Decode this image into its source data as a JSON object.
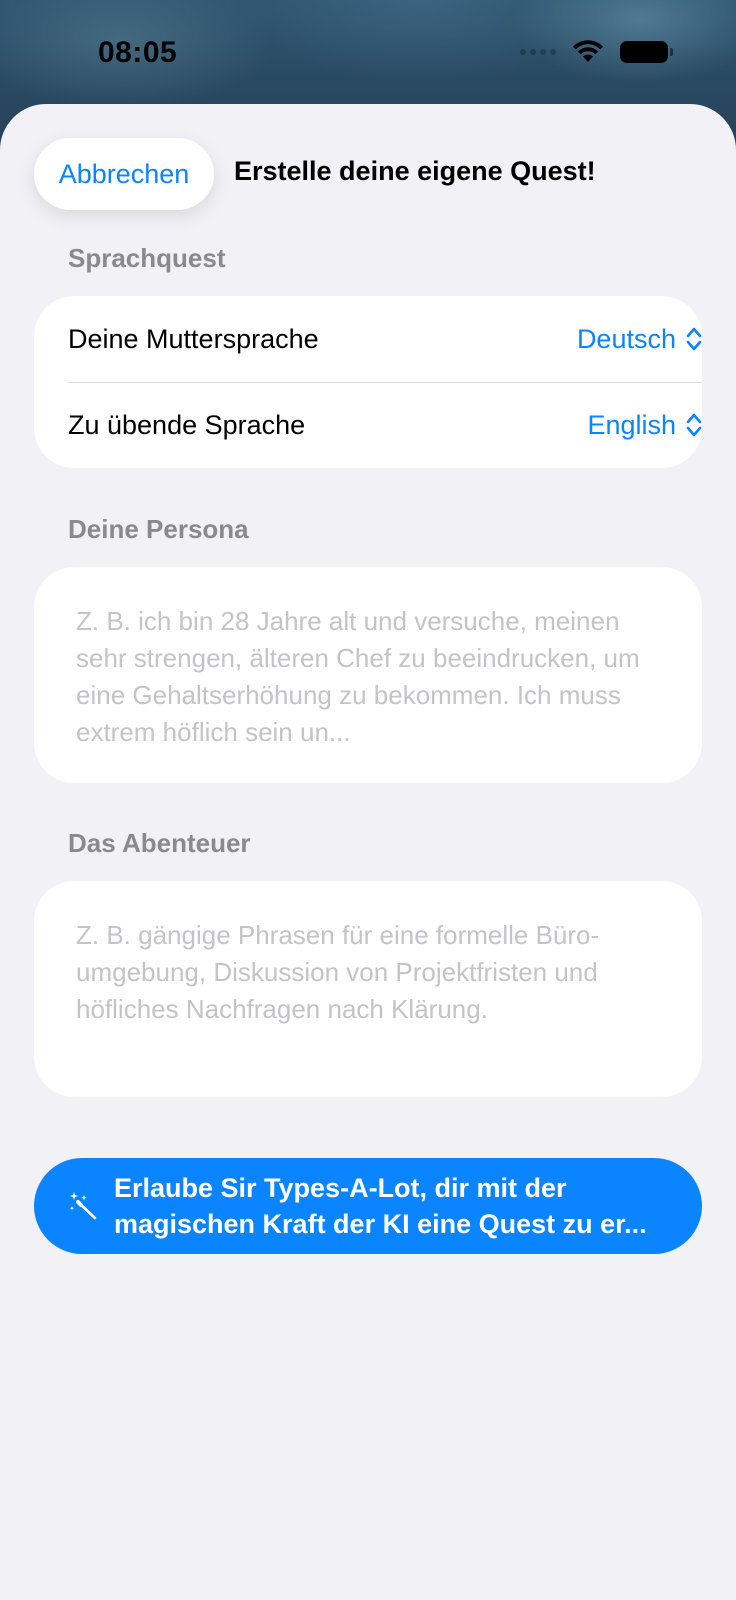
{
  "status_bar": {
    "time": "08:05"
  },
  "nav": {
    "cancel_label": "Abbrechen",
    "title": "Erstelle deine eigene Quest!"
  },
  "language_section": {
    "header": "Sprachquest",
    "rows": [
      {
        "label": "Deine Muttersprache",
        "value": "Deutsch"
      },
      {
        "label": "Zu übende Sprache",
        "value": "English"
      }
    ]
  },
  "persona_section": {
    "header": "Deine Persona",
    "placeholder": "Z. B. ich bin 28 Jahre alt und versuche, meinen sehr strengen, älteren Chef zu beeindrucken, um eine Gehaltserhöhung zu bekommen. Ich muss extrem höflich sein un..."
  },
  "adventure_section": {
    "header": "Das Abenteuer",
    "placeholder": "Z. B. gängige Phrasen für eine formelle Büro-umgebung, Diskussion von Projektfristen und höfliches Nachfragen nach Klärung."
  },
  "ai_button": {
    "line1": "Erlaube Sir Types-A-Lot, dir mit der",
    "line2": "magischen Kraft der KI eine Quest zu er...",
    "icon": "magic-wand-icon"
  },
  "colors": {
    "accent": "#0a84ff",
    "sheet_background": "#f1f1f6",
    "card_background": "#ffffff",
    "section_header": "#8a8a8e",
    "placeholder": "#c4c4c8"
  }
}
